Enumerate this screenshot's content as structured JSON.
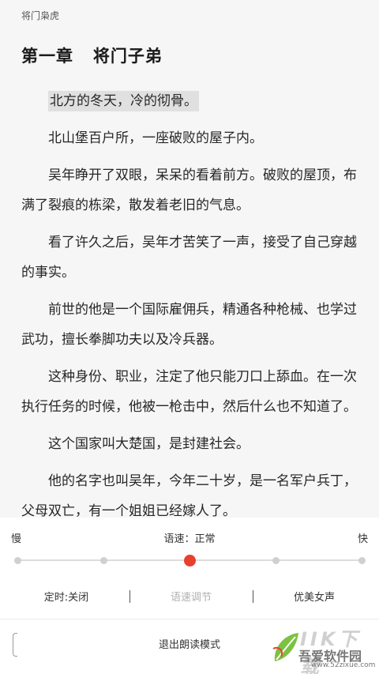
{
  "book": {
    "title": "将门枭虎"
  },
  "chapter": {
    "title": "第一章   将门子弟"
  },
  "paragraphs": [
    "北方的冬天，冷的彻骨。",
    "北山堡百户所，一座破败的屋子内。",
    "吴年睁开了双眼，呆呆的看着前方。破败的屋顶，布满了裂痕的栋梁，散发着老旧的气息。",
    "看了许久之后，吴年才苦笑了一声，接受了自己穿越的事实。",
    "前世的他是一个国际雇佣兵，精通各种枪械、也学过武功，擅长拳脚功夫以及冷兵器。",
    "这种身份、职业，注定了他只能刀口上舔血。在一次执行任务的时候，他被一枪击中，然后什么也不知道了。",
    "这个国家叫大楚国，是封建社会。",
    "他的名字也叫吴年，今年二十岁，是一名军户兵丁，父母双亡，有一个姐姐已经嫁人了。"
  ],
  "reading_panel": {
    "slow_label": "慢",
    "speed_status": "语速：正常",
    "fast_label": "快",
    "speed_steps": 5,
    "speed_selected_index": 2,
    "timer_label": "定时:关闭",
    "speed_adjust_label": "语速调节",
    "voice_label": "优美女声",
    "exit_label": "退出朗读模式",
    "accent_color": "#e8402f"
  },
  "watermark": {
    "latin": "IIK下载",
    "cn": "吾爱软件园",
    "url": "www.52zixue.com"
  }
}
